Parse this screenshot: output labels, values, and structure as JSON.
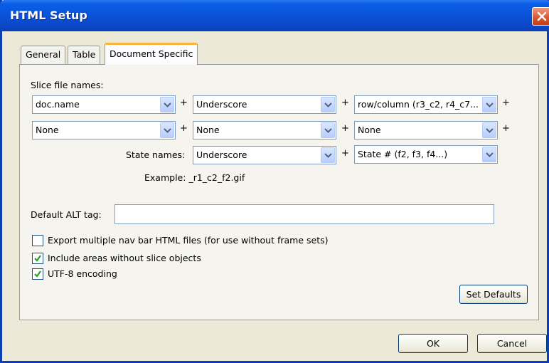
{
  "window": {
    "title": "HTML Setup"
  },
  "tabs": [
    "General",
    "Table",
    "Document Specific"
  ],
  "slice": {
    "label": "Slice file names:",
    "row1": [
      "doc.name",
      "Underscore",
      "row/column (r3_c2, r4_c7..."
    ],
    "row2": [
      "None",
      "None",
      "None"
    ],
    "plus": "+"
  },
  "state": {
    "label": "State names:",
    "values": [
      "Underscore",
      "State # (f2, f3, f4...)"
    ]
  },
  "example": {
    "label": "Example:",
    "value": "_r1_c2_f2.gif"
  },
  "alt": {
    "label": "Default ALT tag:",
    "value": ""
  },
  "options": [
    {
      "label": "Export multiple nav bar HTML files (for use without frame sets)",
      "checked": false
    },
    {
      "label": "Include areas without slice objects",
      "checked": true
    },
    {
      "label": "UTF-8 encoding",
      "checked": true
    }
  ],
  "buttons": {
    "set_defaults": "Set Defaults",
    "ok": "OK",
    "cancel": "Cancel"
  },
  "colors": {
    "titlebar": "#0a52d8",
    "dialog_bg": "#ece9d8",
    "active_tab_accent": "#f9b43c",
    "close_button": "#d9542f"
  },
  "icons": {
    "close": "close-icon",
    "dropdown": "chevron-down-icon",
    "check": "checkmark-icon"
  }
}
